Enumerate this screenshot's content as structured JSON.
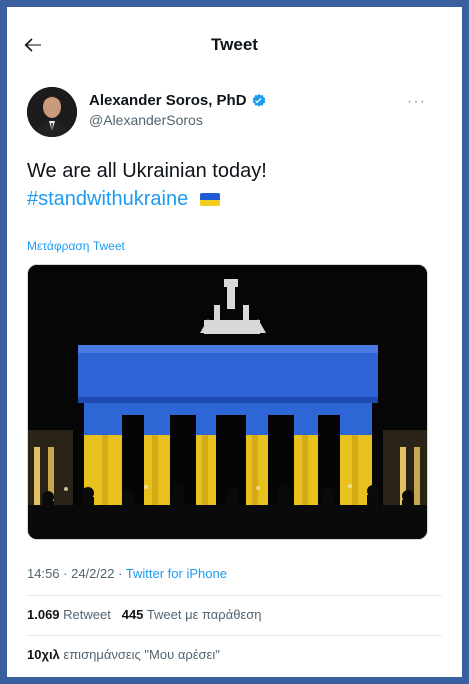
{
  "header": {
    "title": "Tweet"
  },
  "author": {
    "name": "Alexander Soros, PhD",
    "handle": "@AlexanderSoros"
  },
  "more_label": "···",
  "tweet": {
    "text": "We are all Ukrainian today!",
    "hashtag": "#standwithukraine"
  },
  "translate_label": "Μετάφραση Tweet",
  "meta": {
    "time": "14:56 · 24/2/22 · ",
    "source": "Twitter for iPhone"
  },
  "stats": {
    "retweets_count": "1.069",
    "retweets_label": "Retweet",
    "quotes_count": "445",
    "quotes_label": "Tweet με παράθεση",
    "likes_count": "10χιλ",
    "likes_label": "επισημάνσεις \"Μου αρέσει\""
  },
  "colors": {
    "accent": "#1d9bf0",
    "flag_blue": "#1f5bd6",
    "flag_yellow": "#f2cd1f"
  },
  "icons": [
    "back-arrow-icon",
    "verified-badge-icon",
    "more-options-icon",
    "ukraine-flag-icon"
  ]
}
